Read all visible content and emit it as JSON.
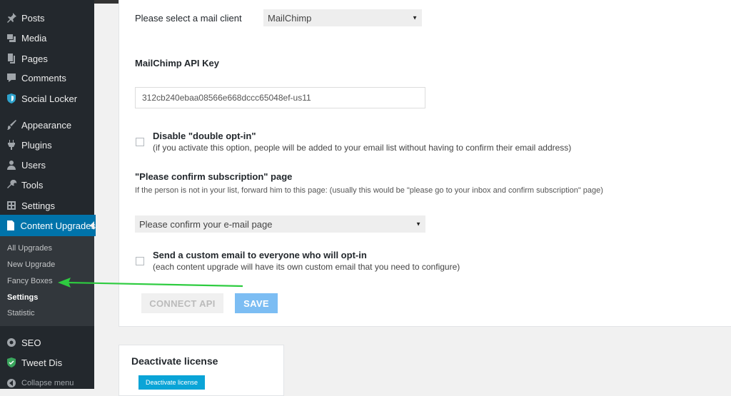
{
  "sidebar": {
    "items": [
      {
        "label": "Posts",
        "icon": "pin-icon"
      },
      {
        "label": "Media",
        "icon": "media-icon"
      },
      {
        "label": "Pages",
        "icon": "pages-icon"
      },
      {
        "label": "Comments",
        "icon": "comment-icon"
      },
      {
        "label": "Social Locker",
        "icon": "shield-icon"
      },
      {
        "label": "Appearance",
        "icon": "brush-icon"
      },
      {
        "label": "Plugins",
        "icon": "plug-icon"
      },
      {
        "label": "Users",
        "icon": "user-icon"
      },
      {
        "label": "Tools",
        "icon": "wrench-icon"
      },
      {
        "label": "Settings",
        "icon": "settings-icon"
      },
      {
        "label": "Content Upgrades",
        "icon": "document-icon"
      },
      {
        "label": "SEO",
        "icon": "seo-icon"
      },
      {
        "label": "Tweet Dis",
        "icon": "shield-icon"
      }
    ],
    "submenu": [
      "All Upgrades",
      "New Upgrade",
      "Fancy Boxes",
      "Settings",
      "Statistic"
    ],
    "collapse_label": "Collapse menu"
  },
  "main": {
    "mail_client": {
      "label": "Please select a mail client",
      "value": "MailChimp"
    },
    "api_key": {
      "label": "MailChimp API Key",
      "value": "312cb240ebaa08566e668dccc65048ef-us11"
    },
    "double_optin": {
      "title": "Disable \"double opt-in\"",
      "description": "(if you activate this option, people will be added to your email list without having to confirm their email address)"
    },
    "confirm_page": {
      "title": "\"Please confirm subscription\" page",
      "description": "If the person is not in your list, forward him to this page: (usually this would be \"please go to your inbox and confirm subscription\" page)",
      "value": "Please confirm your e-mail page"
    },
    "custom_email": {
      "title": "Send a custom email to everyone who will opt-in",
      "description": "(each content upgrade will have its own custom email that you need to configure)"
    },
    "buttons": {
      "connect": "CONNECT API",
      "save": "SAVE"
    }
  },
  "license": {
    "title": "Deactivate license",
    "button": "Deactivate license"
  },
  "colors": {
    "sidebar_bg": "#23282d",
    "active_menu": "#0073aa",
    "save_button": "#7cbdf3",
    "license_button": "#0aa4d7",
    "annotation_arrow": "#2ecc40"
  }
}
